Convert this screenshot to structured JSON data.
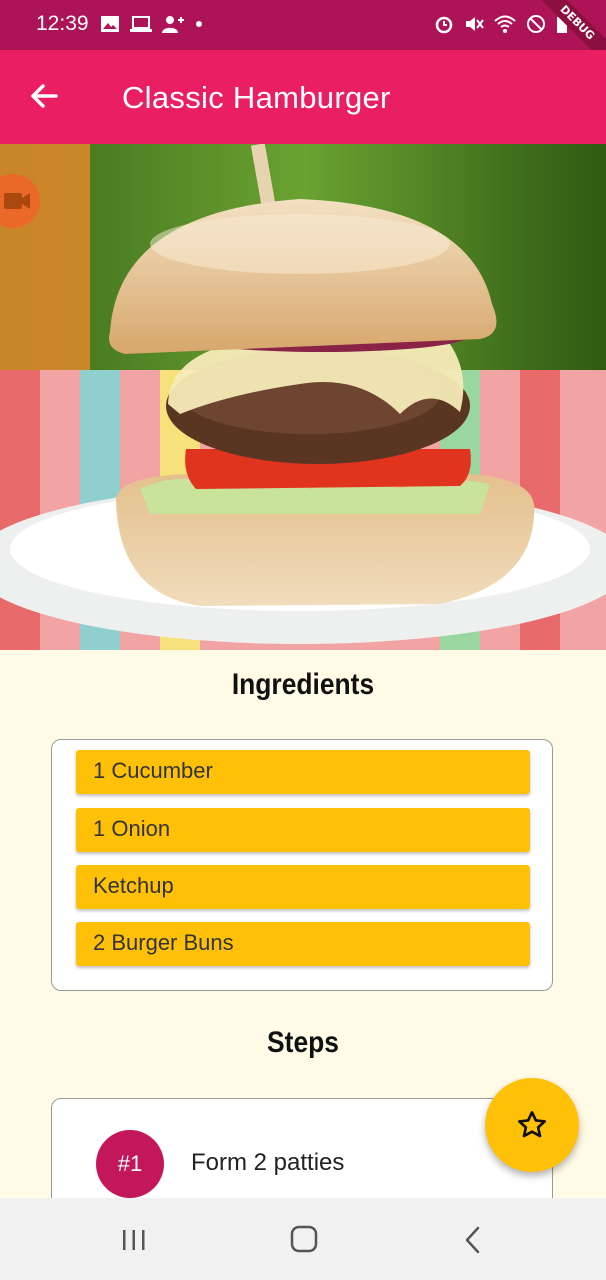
{
  "status_bar": {
    "time": "12:39",
    "debug_label": "DEBUG",
    "icons": [
      "image-icon",
      "laptop-icon",
      "person-add-icon",
      "dot-icon",
      "alarm-icon",
      "mute-icon",
      "wifi-icon",
      "blocked-icon",
      "battery-icon"
    ]
  },
  "app_bar": {
    "title": "Classic Hamburger",
    "back_icon": "arrow-back-icon"
  },
  "ingredients": {
    "title": "Ingredients",
    "items": [
      "1 Cucumber",
      "1 Onion",
      "Ketchup",
      "2 Burger Buns"
    ]
  },
  "steps": {
    "title": "Steps",
    "items": [
      {
        "number": "#1",
        "text": "Form 2 patties"
      }
    ]
  },
  "fab": {
    "icon": "star-outline-icon"
  },
  "nav_bar": {
    "icons": [
      "recent-apps-icon",
      "home-icon",
      "back-icon"
    ]
  },
  "colors": {
    "status_bar": "#ad1457",
    "app_bar": "#e91e63",
    "accent": "#ffc107",
    "step_badge": "#c2185b",
    "background": "#fffbe6"
  }
}
